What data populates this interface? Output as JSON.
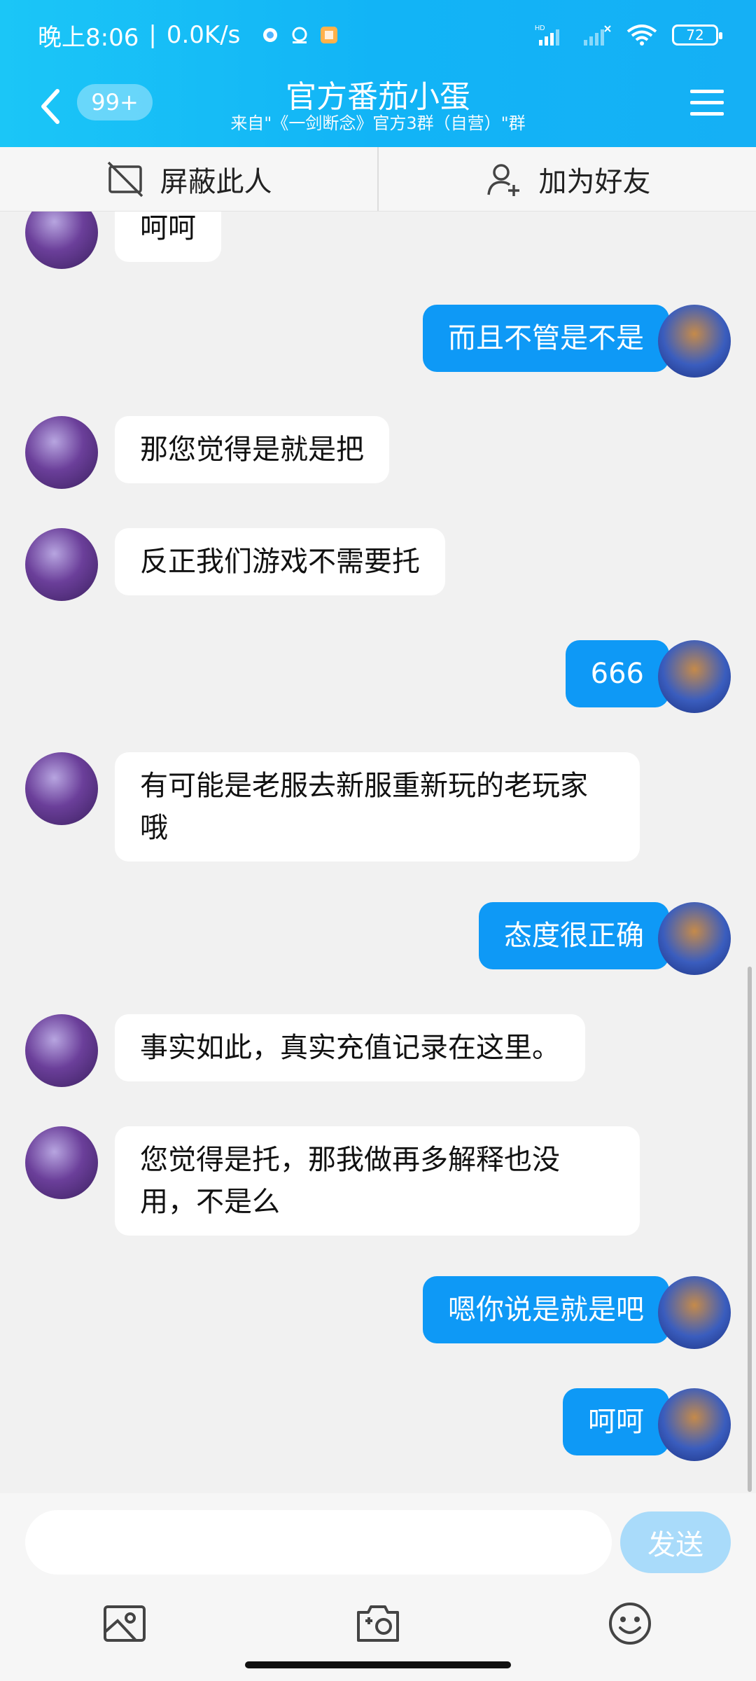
{
  "status_bar": {
    "time": "晚上8:06",
    "separator": "|",
    "speed": "0.0K/s",
    "battery": "72"
  },
  "header": {
    "badge": "99+",
    "title": "官方番茄小蛋",
    "subtitle": "来自\"《一剑断念》官方3群（自营）\"群"
  },
  "actions": {
    "block": "屏蔽此人",
    "add_friend": "加为好友"
  },
  "messages": [
    {
      "side": "left",
      "text": "呵呵"
    },
    {
      "side": "right",
      "text": "而且不管是不是"
    },
    {
      "side": "left",
      "text": "那您觉得是就是把"
    },
    {
      "side": "left",
      "text": "反正我们游戏不需要托"
    },
    {
      "side": "right",
      "text": "666"
    },
    {
      "side": "left",
      "text": "有可能是老服去新服重新玩的老玩家哦"
    },
    {
      "side": "right",
      "text": "态度很正确"
    },
    {
      "side": "left",
      "text": "事实如此，真实充值记录在这里。"
    },
    {
      "side": "left",
      "text": "您觉得是托，那我做再多解释也没用，不是么"
    },
    {
      "side": "right",
      "text": "嗯你说是就是吧"
    },
    {
      "side": "right",
      "text": "呵呵"
    }
  ],
  "composer": {
    "placeholder": "",
    "send": "发送"
  },
  "icons": {
    "back": "chevron-left-icon",
    "menu": "hamburger-menu-icon",
    "block": "block-user-icon",
    "add_friend": "add-friend-icon",
    "photo": "photo-icon",
    "camera": "camera-icon",
    "emoji": "emoji-icon"
  }
}
